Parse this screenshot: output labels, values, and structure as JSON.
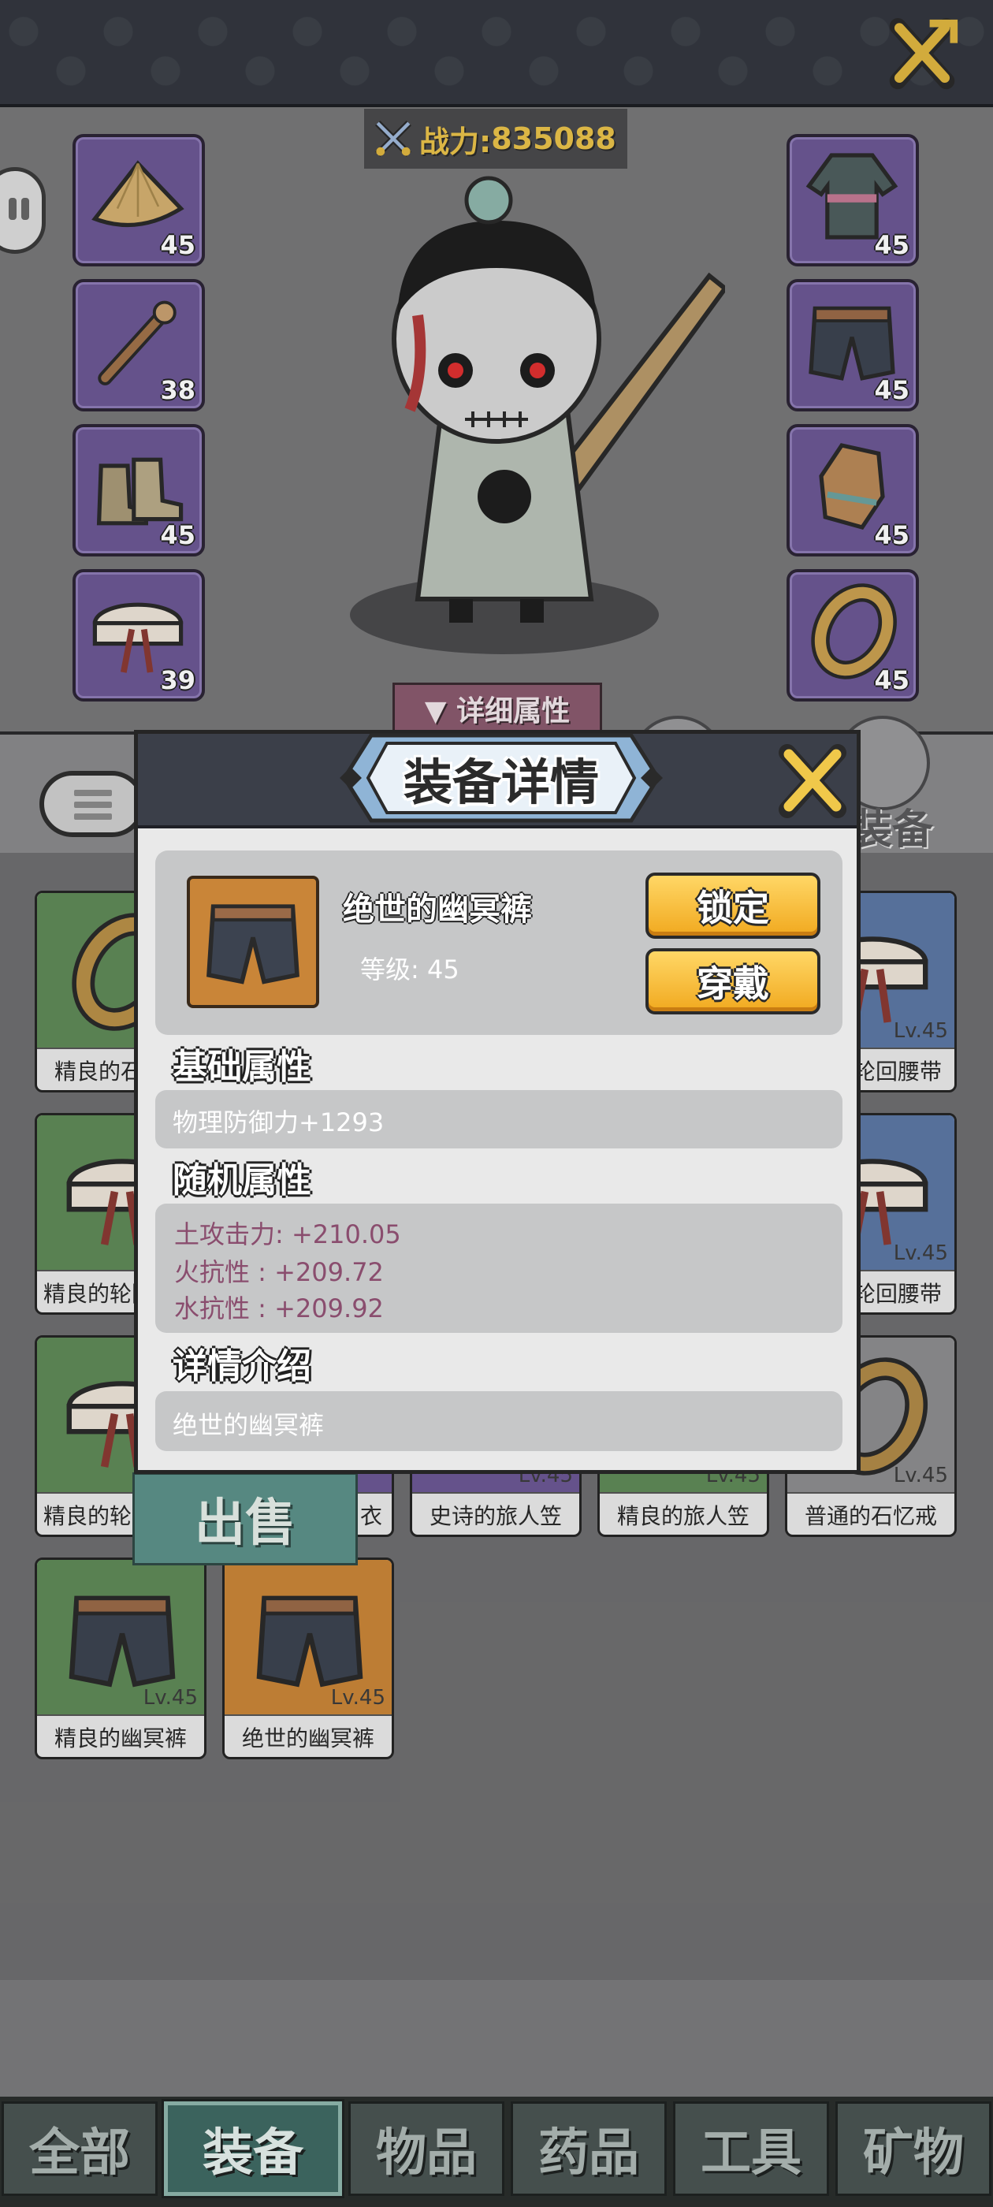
{
  "power": {
    "label": "战力:",
    "value": "835088"
  },
  "character": {
    "detail_button": "▼ 详细属性",
    "left_slots": [
      {
        "icon": "straw-hat-icon",
        "level": "45"
      },
      {
        "icon": "staff-icon",
        "level": "38"
      },
      {
        "icon": "boots-icon",
        "level": "45"
      },
      {
        "icon": "belt-icon",
        "level": "39"
      }
    ],
    "right_slots": [
      {
        "icon": "robe-icon",
        "level": "45"
      },
      {
        "icon": "pants-icon",
        "level": "45"
      },
      {
        "icon": "gloves-icon",
        "level": "45"
      },
      {
        "icon": "ring-icon",
        "level": "45"
      }
    ]
  },
  "toolbar": {
    "equip_label": "装备"
  },
  "inventory": [
    {
      "name": "精良的石忆戒",
      "quality": "green",
      "icon": "ring-icon",
      "level": ""
    },
    {
      "name": "精良的轮回腰带",
      "quality": "green",
      "icon": "belt-icon",
      "level": ""
    },
    {
      "name": "精良的轮回腰带",
      "quality": "green",
      "icon": "belt-icon",
      "level": ""
    },
    {
      "name": "绝世的幽冥裤",
      "quality": "orange",
      "icon": "pants-icon",
      "level": "Lv.45"
    },
    {
      "name": "精良的幽冥裤",
      "quality": "green",
      "icon": "pants-icon",
      "level": "Lv.45"
    }
  ],
  "inventory_right": [
    {
      "name": "轮回腰带",
      "quality": "blue",
      "icon": "belt-icon",
      "level": "Lv.45"
    },
    {
      "name": "轮回腰带",
      "quality": "blue",
      "icon": "belt-icon",
      "level": "Lv.45"
    },
    {
      "name": "普通的石忆戒",
      "quality": "gray",
      "icon": "ring-icon",
      "level": "Lv.45"
    }
  ],
  "inventory_row3": [
    {
      "name": "衣",
      "quality": "purple",
      "icon": "robe-icon",
      "level": "Lv.45"
    },
    {
      "name": "史诗的旅人笠",
      "quality": "purple",
      "icon": "straw-hat-icon",
      "level": "Lv.45"
    },
    {
      "name": "精良的旅人笠",
      "quality": "green",
      "icon": "straw-hat-icon",
      "level": "Lv.45"
    }
  ],
  "sell_label": "出售",
  "tabs": [
    {
      "label": "全部",
      "active": false
    },
    {
      "label": "装备",
      "active": true
    },
    {
      "label": "物品",
      "active": false
    },
    {
      "label": "药品",
      "active": false
    },
    {
      "label": "工具",
      "active": false
    },
    {
      "label": "矿物",
      "active": false
    }
  ],
  "modal": {
    "title": "装备详情",
    "item_name": "绝世的幽冥裤",
    "item_level": "等级: 45",
    "lock_button": "锁定",
    "wear_button": "穿戴",
    "basic_title": "基础属性",
    "basic_attr": "物理防御力+1293",
    "random_title": "随机属性",
    "random_attrs": [
      "土攻击力: +210.05",
      "火抗性 : +209.72",
      "水抗性 : +209.92"
    ],
    "intro_title": "详情介绍",
    "intro_text": "绝世的幽冥裤"
  },
  "colors": {
    "power_gold": "#e9c24a",
    "button_yellow": "#f1a91f",
    "quality_purple": "#6c5894",
    "quality_green": "#5f8a58",
    "quality_blue": "#5c77a4",
    "quality_orange": "#c98538",
    "random_attr_text": "#8a4d6e"
  }
}
